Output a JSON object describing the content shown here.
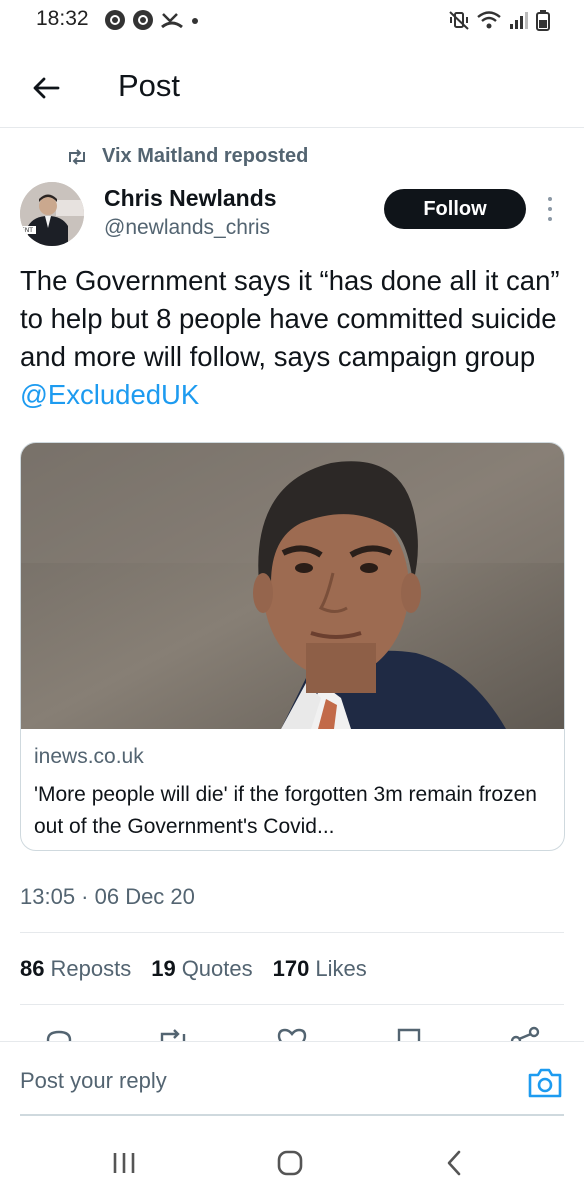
{
  "status_bar": {
    "time": "18:32",
    "left_icons": [
      "chrome-icon",
      "chrome-icon",
      "missed-call-icon",
      "dot-icon"
    ],
    "right_icons": [
      "mute-vibrate-icon",
      "wifi-icon",
      "signal-icon",
      "battery-icon"
    ]
  },
  "header": {
    "title": "Post",
    "back_icon": "arrow-left-icon"
  },
  "post": {
    "reposted_by": "Vix Maitland reposted",
    "author_name": "Chris Newlands",
    "author_handle": "@newlands_chris",
    "follow_label": "Follow",
    "text_main": "The Government says it “has done all it can” to help but 8 people have committed suicide and more will follow, says campaign group ",
    "text_mention": "@ExcludedUK",
    "card": {
      "domain": "inews.co.uk",
      "title": "'More people will die' if the forgotten 3m remain frozen out of the Government's Covid..."
    },
    "timestamp": "13:05 · 06 Dec 20",
    "stats": {
      "reposts_count": "86",
      "reposts_label": "Reposts",
      "quotes_count": "19",
      "quotes_label": "Quotes",
      "likes_count": "170",
      "likes_label": "Likes"
    },
    "actions": [
      "reply-icon",
      "repost-icon",
      "like-icon",
      "bookmark-icon",
      "share-icon"
    ]
  },
  "reply_bar": {
    "placeholder": "Post your reply",
    "camera_icon": "camera-icon"
  },
  "nav_bar": [
    "recent-apps-icon",
    "home-icon",
    "back-icon"
  ],
  "colors": {
    "accent": "#1d9bf0",
    "text": "#0f1419",
    "secondary_text": "#536471",
    "follow_bg": "#0f1419",
    "border": "#cfd9de"
  }
}
